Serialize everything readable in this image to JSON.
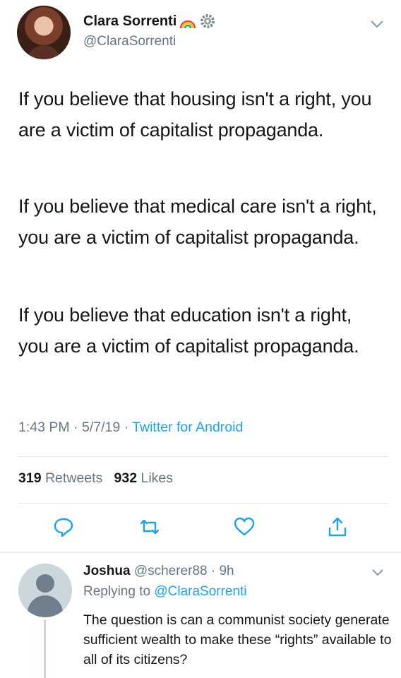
{
  "tweet": {
    "author": {
      "name": "Clara Sorrenti",
      "handle": "@ClaraSorrenti"
    },
    "name_emojis": [
      "rainbow-icon",
      "gear-icon"
    ],
    "paragraphs": [
      "If you believe that housing isn't a right, you are a victim of capitalist propaganda.",
      "If you believe that medical care isn't a right, you are a victim of capitalist propaganda.",
      "If you believe that education isn't a right, you are a victim of capitalist propaganda."
    ],
    "time": "1:43 PM",
    "date": "5/7/19",
    "source": "Twitter for Android",
    "retweets_count": "319",
    "retweets_label": "Retweets",
    "likes_count": "932",
    "likes_label": "Likes"
  },
  "actions": [
    "reply-icon",
    "retweet-icon",
    "like-icon",
    "share-icon"
  ],
  "reply": {
    "name": "Joshua",
    "handle": "@scherer88",
    "time": "9h",
    "replying_prefix": "Replying to",
    "replying_to": "@ClaraSorrenti",
    "text": "The question is can a communist society generate sufficient wealth to make these “rights” available to all of its citizens?"
  },
  "colors": {
    "link": "#1da1f2",
    "muted": "#657786",
    "text": "#14171a",
    "divider": "#e1e8ed"
  }
}
